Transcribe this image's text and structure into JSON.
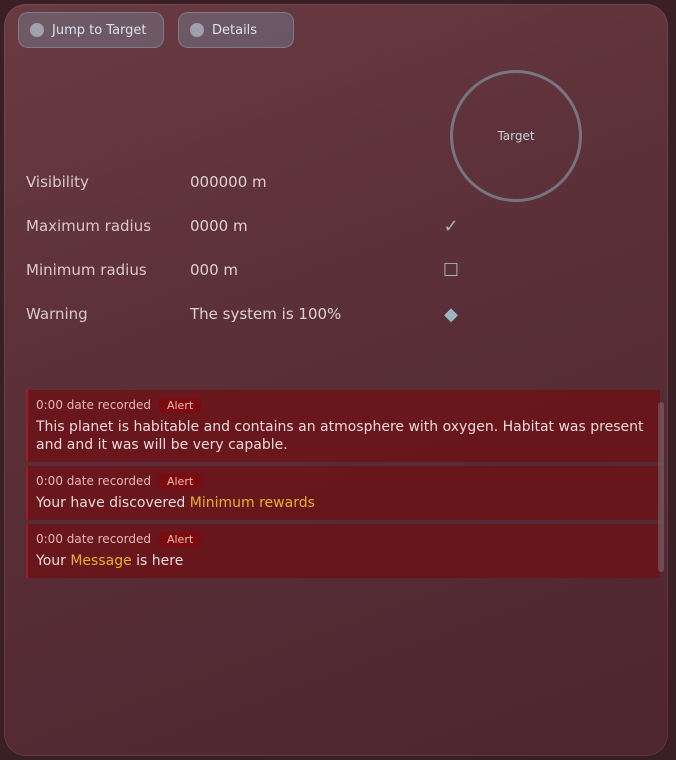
{
  "toolbar": {
    "primary_label": "Jump to Target",
    "secondary_label": "Details",
    "primary_icon": "star-icon",
    "secondary_icon": "info-icon"
  },
  "reticle": {
    "label": "Target"
  },
  "stats": [
    {
      "label": "Visibility",
      "value": "000000 m",
      "mark": ""
    },
    {
      "label": "Maximum radius",
      "value": "0000 m",
      "mark": "✓"
    },
    {
      "label": "Minimum radius",
      "value": "000 m",
      "mark": "☐"
    },
    {
      "label": "Warning",
      "value": "The system is 100%",
      "mark": "◆"
    }
  ],
  "log": [
    {
      "time": "0:00 date recorded",
      "tag": "Alert",
      "message": "This planet is habitable and contains an atmosphere with oxygen. Habitat was present and and it was will be very capable.",
      "highlight": ""
    },
    {
      "time": "0:00 date recorded",
      "tag": "Alert",
      "message": "Your have discovered",
      "highlight": "Minimum rewards"
    },
    {
      "time": "0:00 date recorded",
      "tag": "Alert",
      "message_prefix": "Your",
      "highlight": "Message",
      "message_suffix": "is here"
    }
  ],
  "colors": {
    "panel_bg": "#5a2f37",
    "log_bg": "#6e1016",
    "highlight": "#e6b12a",
    "accent": "#9fb4c2"
  }
}
